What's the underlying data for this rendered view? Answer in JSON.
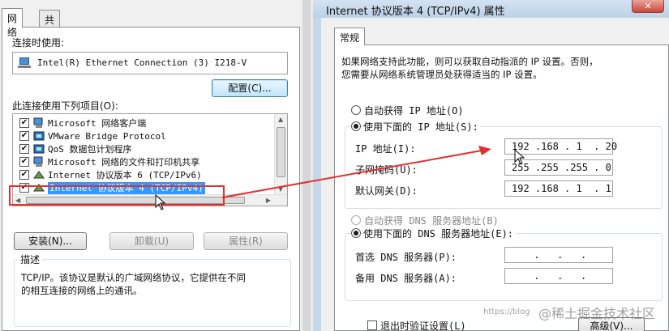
{
  "left_dialog": {
    "tabs": [
      {
        "label": "网络"
      },
      {
        "label": "共享"
      }
    ],
    "connect_using_label": "连接时使用:",
    "adapter_name": "Intel(R) Ethernet Connection (3) I218-V",
    "configure_button": "配置(C)...",
    "items_label": "此连接使用下列项目(O):",
    "items": [
      {
        "label": "Microsoft 网络客户端",
        "checked": true,
        "icon": "network-client-icon"
      },
      {
        "label": "VMware Bridge Protocol",
        "checked": true,
        "icon": "protocol-icon"
      },
      {
        "label": "QoS 数据包计划程序",
        "checked": true,
        "icon": "qos-icon"
      },
      {
        "label": "Microsoft 网络的文件和打印机共享",
        "checked": true,
        "icon": "file-share-icon"
      },
      {
        "label": "Internet 协议版本 6 (TCP/IPv6)",
        "checked": true,
        "icon": "protocol-icon"
      },
      {
        "label": "Internet 协议版本 4 (TCP/IPv4)",
        "checked": true,
        "icon": "protocol-icon",
        "selected": true
      }
    ],
    "install_button": "安装(N)...",
    "uninstall_button": "卸载(U)",
    "properties_button": "属性(R)",
    "description_label": "描述",
    "description_text_1": "TCP/IP。该协议是默认的广域网络协议，它提供在不同",
    "description_text_2": "的相互连接的网络上的通讯。"
  },
  "right_dialog": {
    "title": "Internet 协议版本 4 (TCP/IPv4) 属性",
    "close_glyph": "✕",
    "tab": "常规",
    "intro_1": "如果网络支持此功能，则可以获取自动指派的 IP 设置。否则，",
    "intro_2": "您需要从网络系统管理员处获得适当的 IP 设置。",
    "auto_ip_label": "自动获得 IP 地址(O)",
    "manual_ip_label": "使用下面的 IP 地址(S):",
    "ip_mode": "manual",
    "ip_label": "IP 地址(I):",
    "ip_value": "192 .168 . 1  . 20",
    "mask_label": "子网掩码(U):",
    "mask_value": "255 .255 .255 . 0",
    "gateway_label": "默认网关(D):",
    "gateway_value": "192 .168 . 1  . 1",
    "auto_dns_label": "自动获得 DNS 服务器地址(B)",
    "manual_dns_label": "使用下面的 DNS 服务器地址(E):",
    "dns_mode": "manual",
    "preferred_dns_label": "首选 DNS 服务器(P):",
    "preferred_dns_value": " .   .   . ",
    "alternate_dns_label": "备用 DNS 服务器(A):",
    "alternate_dns_value": " .   .   . ",
    "validate_label": "退出时验证设置(L)",
    "advanced_button": "高级(V)..."
  },
  "watermark": "@稀土掘金技术社区",
  "watermark_url": "https://blog"
}
